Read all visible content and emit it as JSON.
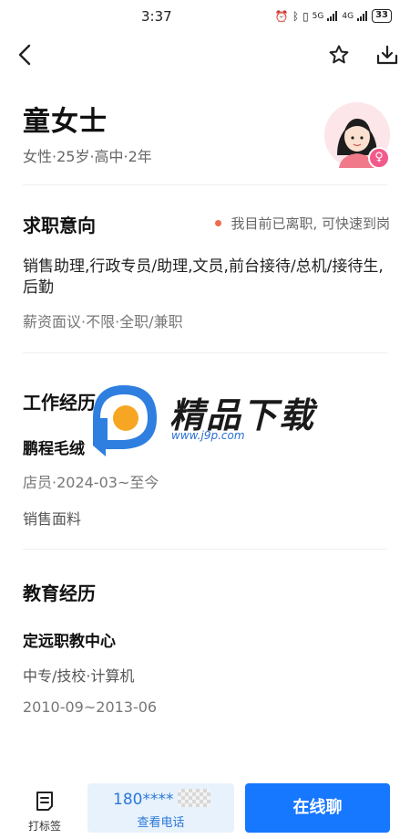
{
  "status_bar": {
    "time": "3:37",
    "network_1": "5G",
    "network_2": "4G",
    "battery": "33"
  },
  "profile": {
    "name": "童女士",
    "meta": "女性·25岁·高中·2年",
    "gender_symbol": "♀"
  },
  "job_intent": {
    "title": "求职意向",
    "status": "我目前已离职, 可快速到岗",
    "positions": "销售助理,行政专员/助理,文员,前台接待/总机/接待生,后勤",
    "details": "薪资面议·不限·全职/兼职"
  },
  "work_experience": {
    "title": "工作经历",
    "company": "鹏程毛绒",
    "role_period": "店员·2024-03~至今",
    "description": "销售面料"
  },
  "education": {
    "title": "教育经历",
    "school": "定远职教中心",
    "degree_major": "中专/技校·计算机",
    "period": "2010-09~2013-06"
  },
  "watermark": {
    "text": "精品下载",
    "url": "www.j9p.com"
  },
  "bottom_bar": {
    "tag_label": "打标签",
    "phone_number": "180****",
    "phone_label": "查看电话",
    "chat_label": "在线聊"
  },
  "colors": {
    "accent": "#1677ff",
    "status_dot": "#ee6b4d",
    "gender_badge": "#f25a8a",
    "phone_bg": "#e8f2fd"
  }
}
